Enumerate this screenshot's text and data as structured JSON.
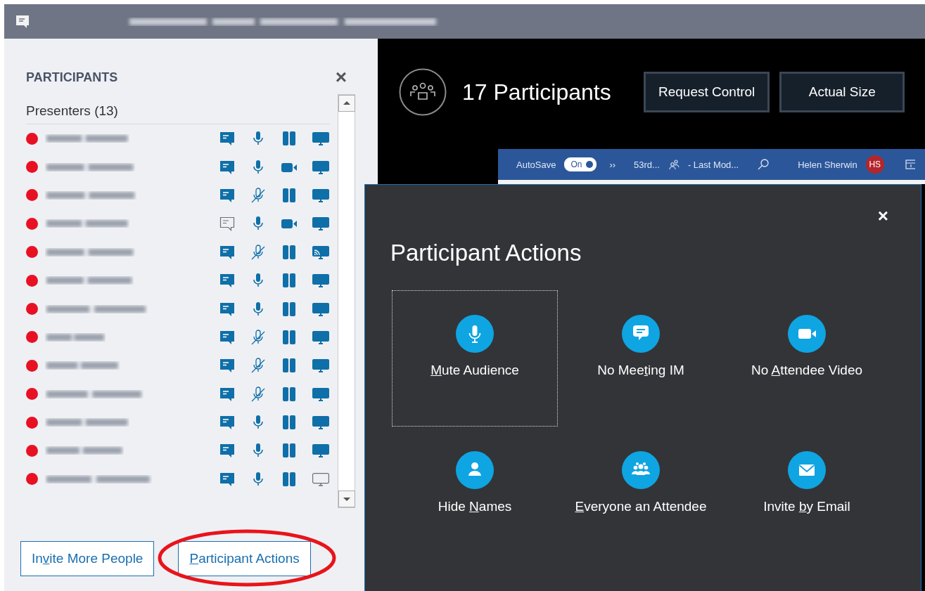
{
  "participants_panel": {
    "title": "PARTICIPANTS",
    "close": "×",
    "group": "Presenters (13)",
    "rows": [
      {
        "color": "#e81123",
        "im": true,
        "muted": false,
        "camera": false,
        "sharing": true,
        "casting": false
      },
      {
        "color": "#e81123",
        "im": true,
        "muted": false,
        "camera": true,
        "sharing": true,
        "casting": false
      },
      {
        "color": "#e81123",
        "im": true,
        "muted": true,
        "camera": false,
        "sharing": true,
        "casting": false
      },
      {
        "color": "#e81123",
        "im": false,
        "muted": false,
        "camera": true,
        "sharing": true,
        "casting": false
      },
      {
        "color": "#e81123",
        "im": true,
        "muted": true,
        "camera": false,
        "sharing": true,
        "casting": true
      },
      {
        "color": "#e81123",
        "im": true,
        "muted": false,
        "camera": false,
        "sharing": true,
        "casting": false
      },
      {
        "color": "#e81123",
        "im": true,
        "muted": false,
        "camera": false,
        "sharing": true,
        "casting": false
      },
      {
        "color": "#e81123",
        "im": true,
        "muted": true,
        "camera": false,
        "sharing": true,
        "casting": false
      },
      {
        "color": "#e81123",
        "im": true,
        "muted": true,
        "camera": false,
        "sharing": true,
        "casting": false
      },
      {
        "color": "#e81123",
        "im": true,
        "muted": true,
        "camera": false,
        "sharing": true,
        "casting": false
      },
      {
        "color": "#e81123",
        "im": true,
        "muted": false,
        "camera": false,
        "sharing": true,
        "casting": false
      },
      {
        "color": "#e81123",
        "im": true,
        "muted": false,
        "camera": false,
        "sharing": true,
        "casting": false
      },
      {
        "color": "#e81123",
        "im": true,
        "muted": false,
        "camera": false,
        "sharing": false,
        "casting": false
      }
    ],
    "buttons": [
      {
        "pre": "In",
        "key": "v",
        "post": "ite More People",
        "highlighted": false
      },
      {
        "key": "P",
        "post": "articipant Actions",
        "highlighted": true
      }
    ]
  },
  "stage": {
    "count": "17 Participants",
    "buttons": [
      "Request Control",
      "Actual Size"
    ],
    "shared_window": {
      "autosave": "AutoSave",
      "toggle": "On",
      "toggle_on": true,
      "more": "››",
      "doc": "53rd...",
      "modified": "- Last Mod...",
      "user": "Helen Sherwin",
      "initials": "HS"
    }
  },
  "actions_dialog": {
    "close": "×",
    "title": "Participant Actions",
    "items": [
      {
        "kind": "mic",
        "key": "M",
        "post": "ute Audience",
        "focused": true
      },
      {
        "kind": "chat",
        "pre": "No Mee",
        "key": "t",
        "post": "ing IM",
        "focused": false
      },
      {
        "kind": "camera",
        "pre": "No ",
        "key": "A",
        "post": "ttendee Video",
        "focused": false
      },
      {
        "kind": "person",
        "pre": "Hide ",
        "key": "N",
        "post": "ames",
        "focused": false
      },
      {
        "kind": "group",
        "key": "E",
        "post": "veryone an Attendee",
        "focused": false
      },
      {
        "kind": "mail",
        "pre": "Invite ",
        "key": "b",
        "post": "y Email",
        "focused": false
      }
    ]
  }
}
